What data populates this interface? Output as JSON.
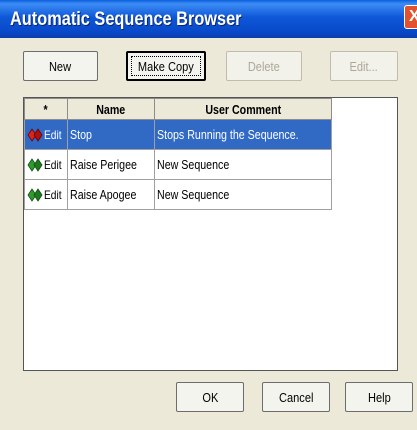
{
  "window": {
    "title": "Automatic Sequence Browser",
    "close_label": "X"
  },
  "toolbar": {
    "new_label": "New",
    "make_copy_label": "Make Copy",
    "delete_label": "Delete",
    "edit_label": "Edit..."
  },
  "table": {
    "columns": [
      "*",
      "Name",
      "User Comment"
    ],
    "rows": [
      {
        "icon": "red-diamond-icon",
        "edit": "Edit",
        "name": "Stop",
        "comment": "Stops Running the Sequence.",
        "selected": true
      },
      {
        "icon": "green-diamond-icon",
        "edit": "Edit",
        "name": "Raise Perigee",
        "comment": "New Sequence",
        "selected": false
      },
      {
        "icon": "green-diamond-icon",
        "edit": "Edit",
        "name": "Raise Apogee",
        "comment": "New Sequence",
        "selected": false
      }
    ]
  },
  "footer": {
    "ok_label": "OK",
    "cancel_label": "Cancel",
    "help_label": "Help"
  },
  "colors": {
    "selection": "#316AC5",
    "titlebar": "#0A5FDC",
    "dialog_bg": "#ECE9D8"
  }
}
